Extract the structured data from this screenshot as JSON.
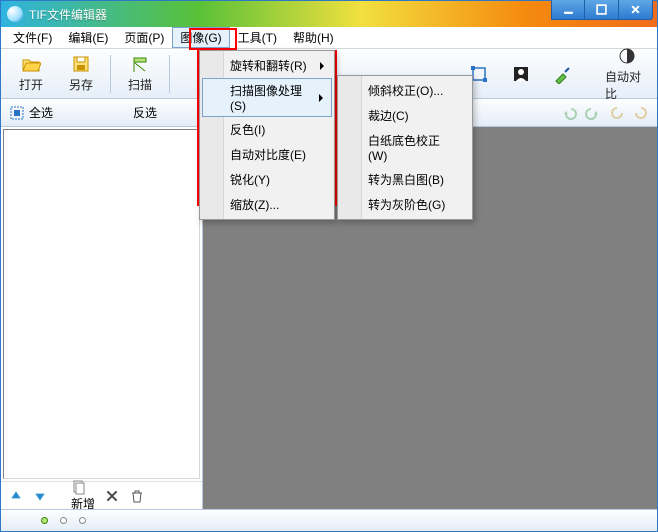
{
  "window": {
    "title": "TIF文件编辑器"
  },
  "menubar": {
    "file": "文件(F)",
    "edit": "编辑(E)",
    "page": "页面(P)",
    "image": "图像(G)",
    "tool": "工具(T)",
    "help": "帮助(H)"
  },
  "toolbar": {
    "open": "打开",
    "save": "另存",
    "scan": "扫描",
    "autocontrast": "自动对比"
  },
  "toolbar2": {
    "selectall": "全选",
    "invert": "反选"
  },
  "lefttools": {
    "new": "新增"
  },
  "image_menu": {
    "rotate": "旋转和翻转(R)",
    "scanproc": "扫描图像处理(S)",
    "invert": "反色(I)",
    "autocontrast": "自动对比度(E)",
    "sharpen": "锐化(Y)",
    "zoom": "缩放(Z)..."
  },
  "scan_submenu": {
    "deskew": "倾斜校正(O)...",
    "crop": "裁边(C)",
    "whitebg": "白纸底色校正(W)",
    "tobw": "转为黑白图(B)",
    "togray": "转为灰阶色(G)"
  }
}
